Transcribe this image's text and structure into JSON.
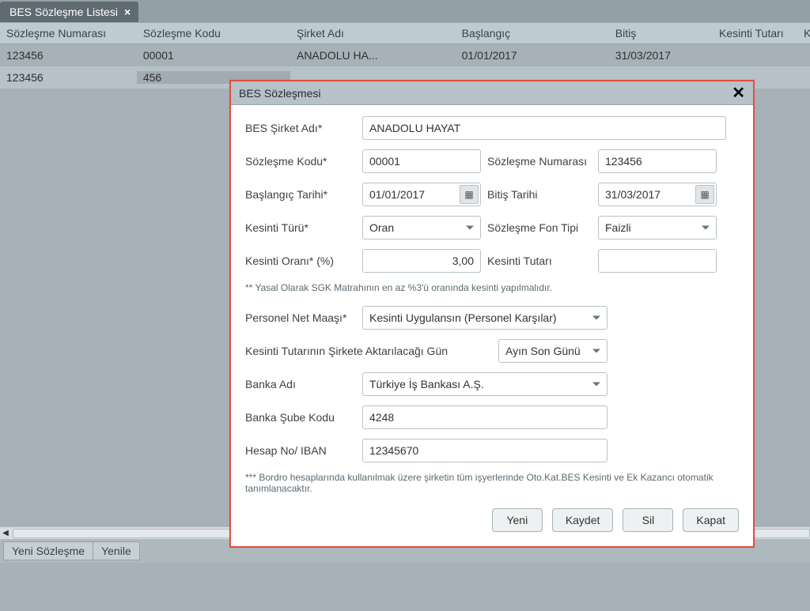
{
  "tab": {
    "title": "BES Sözleşme Listesi"
  },
  "grid": {
    "headers": {
      "c1": "Sözleşme Numarası",
      "c2": "Sözleşme Kodu",
      "c3": "Şirket Adı",
      "c4": "Başlangıç",
      "c5": "Bitiş",
      "c6": "Kesinti Tutarı",
      "c7": "Kesinti Oran"
    },
    "rows": [
      {
        "c1": "123456",
        "c2": "00001",
        "c3": "ANADOLU HA...",
        "c4": "01/01/2017",
        "c5": "31/03/2017",
        "c6": "",
        "c7": ""
      },
      {
        "c1": "123456",
        "c2": "456",
        "c3": "",
        "c4": "",
        "c5": "",
        "c6": "",
        "c7": ""
      }
    ]
  },
  "bottom": {
    "new": "Yeni Sözleşme",
    "refresh": "Yenile"
  },
  "modal": {
    "title": "BES Sözleşmesi",
    "labels": {
      "company": "BES Şirket Adı*",
      "code": "Sözleşme Kodu*",
      "number": "Sözleşme Numarası",
      "start": "Başlangıç Tarihi*",
      "end": "Bitiş Tarihi",
      "ktype": "Kesinti Türü*",
      "fon": "Sözleşme Fon Tipi",
      "rate": "Kesinti Oranı* (%)",
      "amount": "Kesinti Tutarı",
      "net": "Personel Net Maaşı*",
      "transferDay": "Kesinti Tutarının Şirkete Aktarılacağı Gün",
      "bank": "Banka Adı",
      "branch": "Banka Şube Kodu",
      "iban": "Hesap No/ IBAN"
    },
    "values": {
      "company": "ANADOLU HAYAT",
      "code": "00001",
      "number": "123456",
      "start": "01/01/2017",
      "end": "31/03/2017",
      "ktype": "Oran",
      "fon": "Faizli",
      "rate": "3,00",
      "amount": "",
      "net": "Kesinti Uygulansın (Personel Karşılar)",
      "transferDay": "Ayın Son Günü",
      "bank": "Türkiye İş Bankası A.Ş.",
      "branch": "4248",
      "iban": "12345670"
    },
    "note1": "** Yasal Olarak SGK Matrahının en az %3'ü oranında kesinti yapılmalıdır.",
    "note2": "*** Bordro hesaplarında kullanılmak üzere şirketin tüm işyerlerinde Oto.Kat.BES Kesinti ve Ek Kazancı otomatik tanımlanacaktır.",
    "buttons": {
      "new": "Yeni",
      "save": "Kaydet",
      "delete": "Sil",
      "close": "Kapat"
    }
  }
}
